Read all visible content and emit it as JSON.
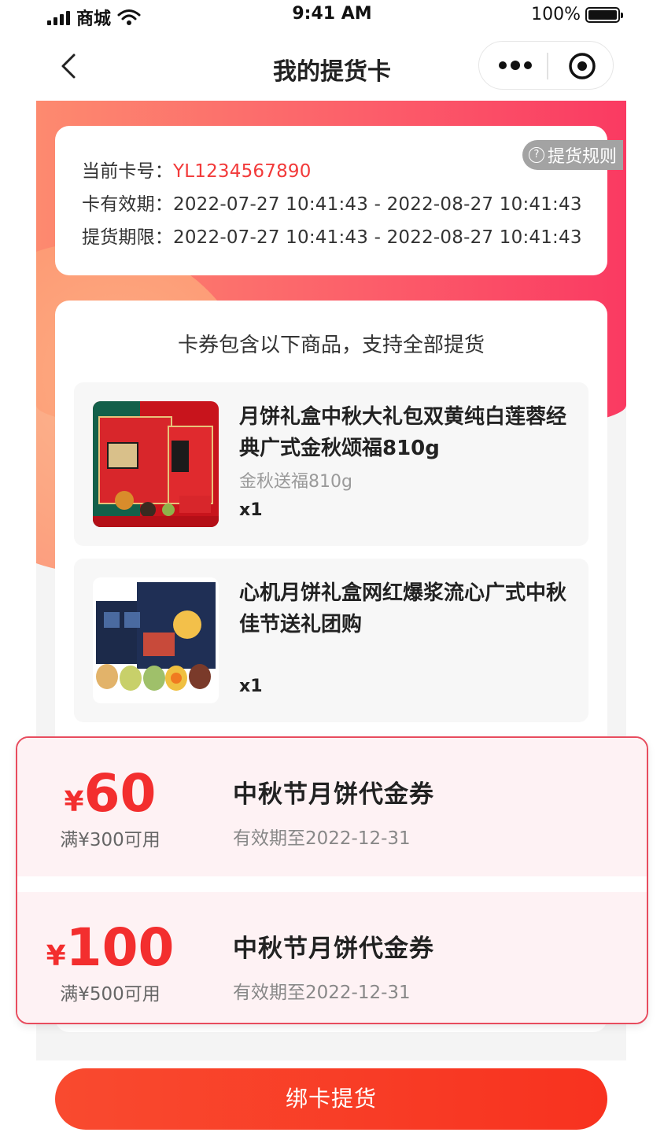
{
  "status_bar": {
    "carrier": "商城",
    "time": "9:41 AM",
    "battery": "100%"
  },
  "nav": {
    "title": "我的提货卡"
  },
  "card_info": {
    "card_no_label": "当前卡号：",
    "card_no": "YL1234567890",
    "validity_label": "卡有效期：",
    "validity": "2022-07-27 10:41:43 - 2022-08-27 10:41:43",
    "pickup_label": "提货期限：",
    "pickup": "2022-07-27 10:41:43 - 2022-08-27 10:41:43",
    "rules_label": "提货规则"
  },
  "goods": {
    "heading": "卡券包含以下商品，支持全部提货",
    "items": [
      {
        "name": "月饼礼盒中秋大礼包双黄纯白莲蓉经典广式金秋颂福810g",
        "spec": "金秋送福810g",
        "qty": "x1"
      },
      {
        "name": "心机月饼礼盒网红爆浆流心广式中秋佳节送礼团购",
        "spec": "",
        "qty": "x1"
      }
    ]
  },
  "coupons": [
    {
      "symbol": "¥",
      "amount": "60",
      "condition": "满¥300可用",
      "title": "中秋节月饼代金券",
      "valid": "有效期至2022-12-31"
    },
    {
      "symbol": "¥",
      "amount": "100",
      "condition": "满¥500可用",
      "title": "中秋节月饼代金券",
      "valid": "有效期至2022-12-31"
    }
  ],
  "bind_button": "绑卡提货",
  "colors": {
    "accent_red": "#f23a3a",
    "button_red": "#f8321f",
    "hero_gradient_start": "#fd8a6f",
    "hero_gradient_end": "#fa3a62",
    "coupon_bg": "#fef2f4",
    "coupon_border": "#e84c5e"
  },
  "icons": {
    "back": "chevron-left-icon",
    "more": "more-dots-icon",
    "target": "target-icon",
    "help": "question-circle-icon"
  }
}
